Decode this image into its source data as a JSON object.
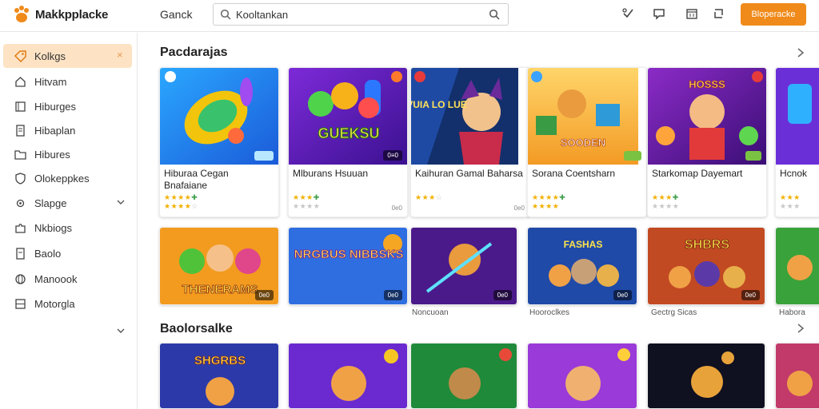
{
  "app": {
    "brand": "Makkpplacke",
    "nav_link": "Ganck",
    "cta_label": "Bloperacke"
  },
  "search": {
    "value": "Kooltankan",
    "placeholder": "Kooltankan"
  },
  "icons": {
    "logo": "paw-logo-icon",
    "search": "search-icon",
    "top": [
      "wishlist-icon",
      "chat-icon",
      "calendar-icon",
      "share-icon"
    ]
  },
  "colors": {
    "accent": "#f08a1a",
    "active_bg": "#fde3c4",
    "star": "#f2b100",
    "star_green": "#3ea04a"
  },
  "sidebar": {
    "items": [
      {
        "label": "Kolkgs",
        "icon": "tag-icon",
        "active": true,
        "trail": "×"
      },
      {
        "label": "Hitvam",
        "icon": "home-icon"
      },
      {
        "label": "Hiburges",
        "icon": "book-icon"
      },
      {
        "label": "Hibaplan",
        "icon": "document-icon"
      },
      {
        "label": "Hibures",
        "icon": "folder-icon"
      },
      {
        "label": "Olokeppkes",
        "icon": "shield-icon"
      },
      {
        "label": "Slapge",
        "icon": "gear-icon",
        "expandable": true
      },
      {
        "label": "Nkbiogs",
        "icon": "puzzle-icon"
      },
      {
        "label": "Baolo",
        "icon": "document-icon"
      },
      {
        "label": "Manoook",
        "icon": "globe-icon"
      },
      {
        "label": "Motorgla",
        "icon": "grid-icon"
      }
    ]
  },
  "sections": [
    {
      "title": "Pacdarajas",
      "cards": [
        {
          "title": "Hiburaa Cegan Bnafaiane",
          "rating_top": "★★★★",
          "rating_top_g": "✚",
          "rating_bottom": "★★★★",
          "rating_bottom_e": "☆",
          "badge": "",
          "price": ""
        },
        {
          "title": "Mlburans Hsuuan",
          "rating_top": "★★★",
          "rating_top_g": "✚",
          "rating_bottom": "",
          "rating_bottom_e": "★★★★",
          "badge": "0≡0",
          "price": "0e0",
          "art_text": "GUEKSU"
        },
        {
          "title": "Kaihuran Gamal Baharsa",
          "rating_top": "",
          "rating_top_g": "",
          "rating_bottom": "★★★",
          "rating_bottom_e": "☆",
          "badge": "",
          "price": "0e0",
          "art_text": "VUIA LO LUE"
        },
        {
          "title": "Sorana Coentsharn",
          "rating_top": "★★★★",
          "rating_top_g": "✚",
          "rating_bottom": "★★★★",
          "rating_bottom_e": "",
          "badge": "",
          "price": "",
          "art_text": "SOODEN"
        },
        {
          "title": "Starkomap Dayemart",
          "rating_top": "★★★",
          "rating_top_g": "✚",
          "rating_bottom": "",
          "rating_bottom_e": "★★★★",
          "badge": "",
          "price": "",
          "art_text": "HOSSS"
        },
        {
          "title": "Hcnok",
          "rating_top": "★★★",
          "rating_top_g": "",
          "rating_bottom": "",
          "rating_bottom_e": "★★★",
          "badge": "",
          "price": ""
        }
      ],
      "banners": [
        {
          "caption": "",
          "art_text": "THENERAMS",
          "badge": "0e0"
        },
        {
          "caption": "Noncuoan",
          "art_text": "NRGBUS NIBBSKS",
          "badge": "0e0"
        },
        {
          "caption": "",
          "art_text": "",
          "badge": "0e0"
        },
        {
          "caption": "Hooroclkes",
          "art_text": "FASHAS",
          "badge": "0e0"
        },
        {
          "caption": "Gectrg Sicas",
          "art_text": "SHBRS",
          "badge": "0e0"
        },
        {
          "caption": "Habora",
          "art_text": "",
          "badge": ""
        }
      ]
    },
    {
      "title": "Baolorsalke",
      "tiles": [
        {
          "art_text": "SHGRBS"
        },
        {
          "art_text": ""
        },
        {
          "art_text": ""
        },
        {
          "art_text": ""
        },
        {
          "art_text": ""
        },
        {
          "art_text": ""
        }
      ]
    }
  ]
}
